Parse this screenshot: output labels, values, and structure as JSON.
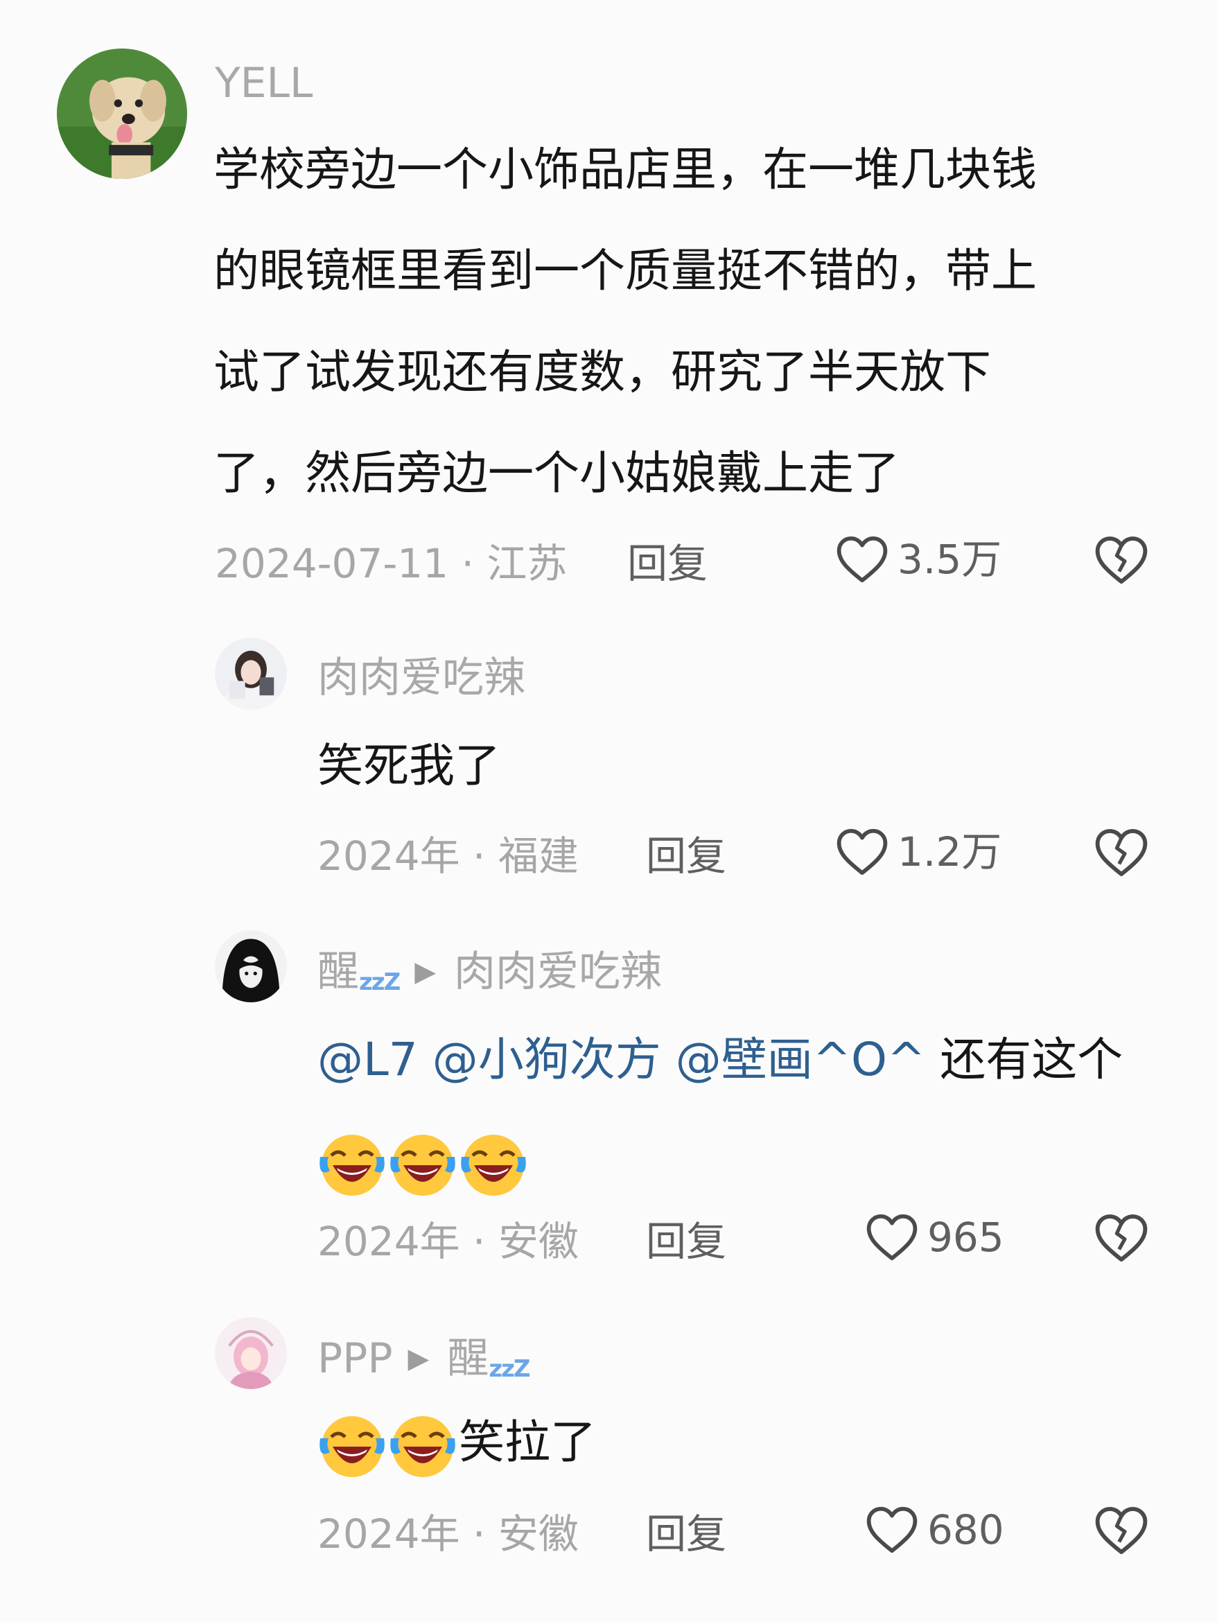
{
  "comments": [
    {
      "username": "YELL",
      "text_lines": [
        "学校旁边一个小饰品店里，在一堆几块钱",
        "的眼镜框里看到一个质量挺不错的，带上",
        "试了试发现还有度数，研究了半天放下",
        "了，然后旁边一个小姑娘戴上走了"
      ],
      "date": "2024-07-11",
      "location": "江苏",
      "reply_label": "回复",
      "likes": "3.5万",
      "avatar_icon": "dog-avatar"
    },
    {
      "username": "肉肉爱吃辣",
      "text": "笑死我了",
      "date": "2024年",
      "location": "福建",
      "reply_label": "回复",
      "likes": "1.2万",
      "avatar_icon": "girl-avatar"
    },
    {
      "username": "醒",
      "username_suffix": "zzZ",
      "reply_to": "肉肉爱吃辣",
      "mentions": [
        "@L7",
        "@小狗次方",
        "@壁画^O^"
      ],
      "text": "还有这个",
      "emoji": [
        "laughing-crying-emoji",
        "laughing-crying-emoji",
        "laughing-crying-emoji"
      ],
      "date": "2024年",
      "location": "安徽",
      "reply_label": "回复",
      "likes": "965",
      "avatar_icon": "dark-hair-avatar"
    },
    {
      "username": "PPP",
      "reply_to": "醒",
      "reply_to_suffix": "zzZ",
      "emoji": [
        "laughing-crying-emoji",
        "laughing-crying-emoji"
      ],
      "text": "笑拉了",
      "date": "2024年",
      "location": "安徽",
      "reply_label": "回复",
      "likes": "680",
      "avatar_icon": "pink-anime-avatar"
    }
  ],
  "separator": "·",
  "colors": {
    "background": "#fbfbfb",
    "text": "#161616",
    "meta": "#a6a6a6",
    "mention": "#2e5f8f"
  }
}
